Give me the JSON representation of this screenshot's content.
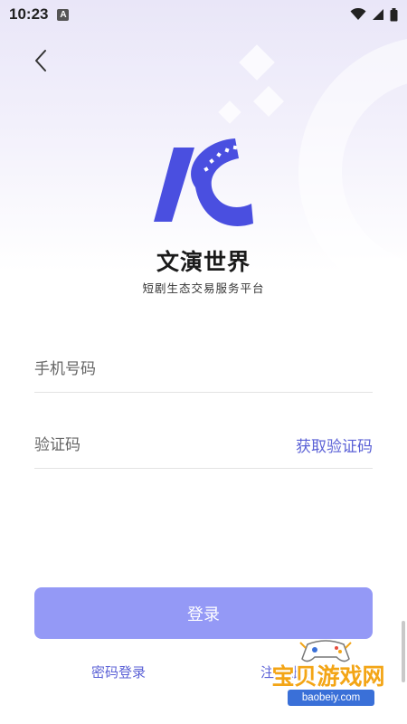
{
  "status_bar": {
    "time": "10:23",
    "notification_letter": "A"
  },
  "header": {
    "back_icon": "chevron-left-icon"
  },
  "brand": {
    "logo_icon": "film-reel-k-logo-icon",
    "name": "文演世界",
    "tagline": "短剧生态交易服务平台"
  },
  "form": {
    "phone": {
      "placeholder": "手机号码",
      "value": ""
    },
    "code": {
      "placeholder": "验证码",
      "value": "",
      "get_code_label": "获取验证码"
    }
  },
  "actions": {
    "login_label": "登录",
    "password_login_label": "密码登录",
    "register_label": "注册账号"
  },
  "watermark": {
    "title": "宝贝游戏网",
    "url": "baobeiy.com"
  },
  "colors": {
    "accent": "#5b61d6",
    "button": "#9499f6",
    "logo_blue": "#4a4fe0",
    "watermark_orange": "#f3a516"
  }
}
